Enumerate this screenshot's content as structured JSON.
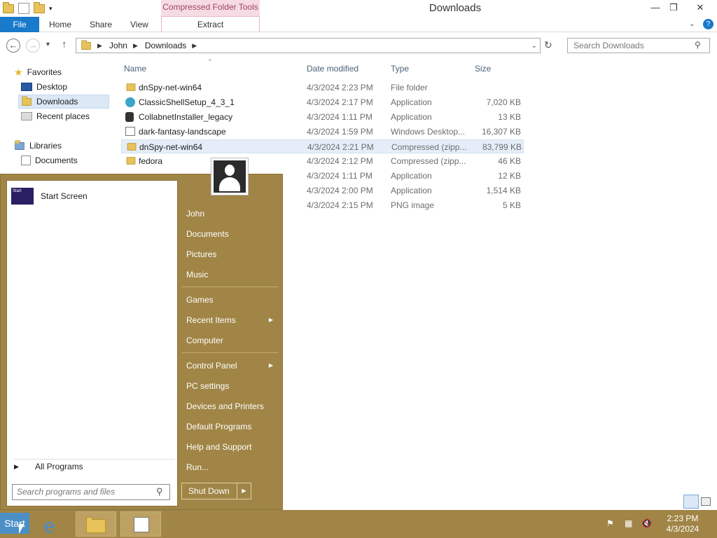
{
  "window": {
    "title": "Downloads",
    "context_tab": "Compressed Folder Tools",
    "minimize": "—",
    "restore": "❐",
    "close": "✕"
  },
  "ribbon": {
    "tabs": [
      "File",
      "Home",
      "Share",
      "View",
      "Extract"
    ]
  },
  "address": {
    "segments": [
      "John",
      "Downloads"
    ],
    "search_placeholder": "Search Downloads"
  },
  "navpane": {
    "items": [
      "Favorites",
      "Desktop",
      "Downloads",
      "Recent places",
      "Libraries",
      "Documents"
    ]
  },
  "filelist": {
    "columns": [
      "Name",
      "Date modified",
      "Type",
      "Size"
    ],
    "rows": [
      {
        "name": "dnSpy-net-win64",
        "date": "4/3/2024 2:23 PM",
        "type": "File folder",
        "size": ""
      },
      {
        "name": "ClassicShellSetup_4_3_1",
        "date": "4/3/2024 2:17 PM",
        "type": "Application",
        "size": "7,020 KB"
      },
      {
        "name": "CollabnetInstaller_legacy",
        "date": "4/3/2024 1:11 PM",
        "type": "Application",
        "size": "13 KB"
      },
      {
        "name": "dark-fantasy-landscape",
        "date": "4/3/2024 1:59 PM",
        "type": "Windows Desktop...",
        "size": "16,307 KB"
      },
      {
        "name": "dnSpy-net-win64",
        "date": "4/3/2024 2:21 PM",
        "type": "Compressed (zipp...",
        "size": "83,799 KB"
      },
      {
        "name": "fedora",
        "date": "4/3/2024 2:12 PM",
        "type": "Compressed (zipp...",
        "size": "46 KB"
      },
      {
        "name": "",
        "date": "4/3/2024 1:11 PM",
        "type": "Application",
        "size": "12 KB"
      },
      {
        "name": "",
        "date": "4/3/2024 2:00 PM",
        "type": "Application",
        "size": "1,514 KB"
      },
      {
        "name": "",
        "date": "4/3/2024 2:15 PM",
        "type": "PNG image",
        "size": "5 KB"
      }
    ]
  },
  "startmenu": {
    "pinned": "Start Screen",
    "tile_text": "Start",
    "all_programs": "All Programs",
    "search_placeholder": "Search programs and files",
    "right_items": [
      "John",
      "Documents",
      "Pictures",
      "Music",
      "Games",
      "Recent Items",
      "Computer",
      "Control Panel",
      "PC settings",
      "Devices and Printers",
      "Default Programs",
      "Help and Support",
      "Run..."
    ],
    "shutdown": "Shut Down"
  },
  "taskbar": {
    "start": "Start",
    "time": "2:23 PM",
    "date": "4/3/2024"
  },
  "colors": {
    "accent": "#1979ca",
    "startmenu_bg": "#a08546",
    "context_tab": "#f6dbe3"
  }
}
